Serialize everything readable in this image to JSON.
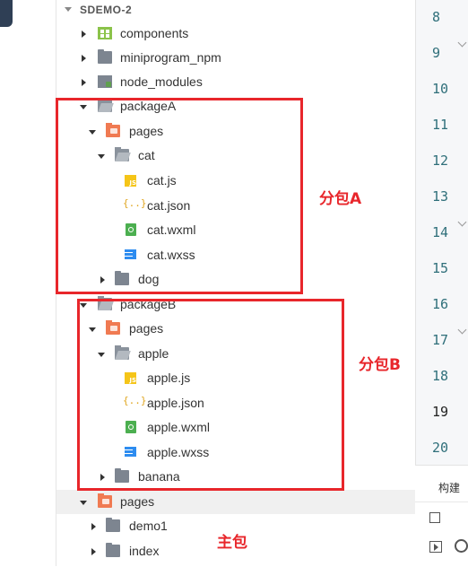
{
  "explorer": {
    "root_label": "SDEMO-2",
    "items": [
      {
        "label": "components"
      },
      {
        "label": "miniprogram_npm"
      },
      {
        "label": "node_modules"
      },
      {
        "label": "packageA"
      },
      {
        "label": "pages"
      },
      {
        "label": "cat"
      },
      {
        "label": "cat.js"
      },
      {
        "label": "cat.json"
      },
      {
        "label": "cat.wxml"
      },
      {
        "label": "cat.wxss"
      },
      {
        "label": "dog"
      },
      {
        "label": "packageB"
      },
      {
        "label": "pages"
      },
      {
        "label": "apple"
      },
      {
        "label": "apple.js"
      },
      {
        "label": "apple.json"
      },
      {
        "label": "apple.wxml"
      },
      {
        "label": "apple.wxss"
      },
      {
        "label": "banana"
      },
      {
        "label": "pages"
      },
      {
        "label": "demo1"
      },
      {
        "label": "index"
      }
    ]
  },
  "annotations": {
    "box_a_label": "分包A",
    "box_b_label": "分包B",
    "main_label": "主包",
    "color": "#e8262b"
  },
  "editor": {
    "line_numbers": [
      "8",
      "9",
      "10",
      "11",
      "12",
      "13",
      "14",
      "15",
      "16",
      "17",
      "18",
      "19",
      "20"
    ],
    "active_line": "19"
  },
  "bottom_panel": {
    "tab_label": "构建"
  },
  "icons": {
    "js_badge": "JS",
    "json_glyph": "{..}"
  }
}
